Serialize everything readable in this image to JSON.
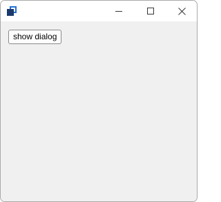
{
  "window": {
    "title": "",
    "icon": "app-window-icon",
    "controls": {
      "minimize_icon": "minimize-icon",
      "maximize_icon": "maximize-icon",
      "close_icon": "close-icon"
    }
  },
  "main": {
    "show_dialog_label": "show dialog"
  },
  "colors": {
    "client_bg": "#f0f0f0",
    "titlebar_bg": "#ffffff",
    "icon_dark": "#1b3a6b",
    "icon_blue": "#1f6fd1"
  }
}
